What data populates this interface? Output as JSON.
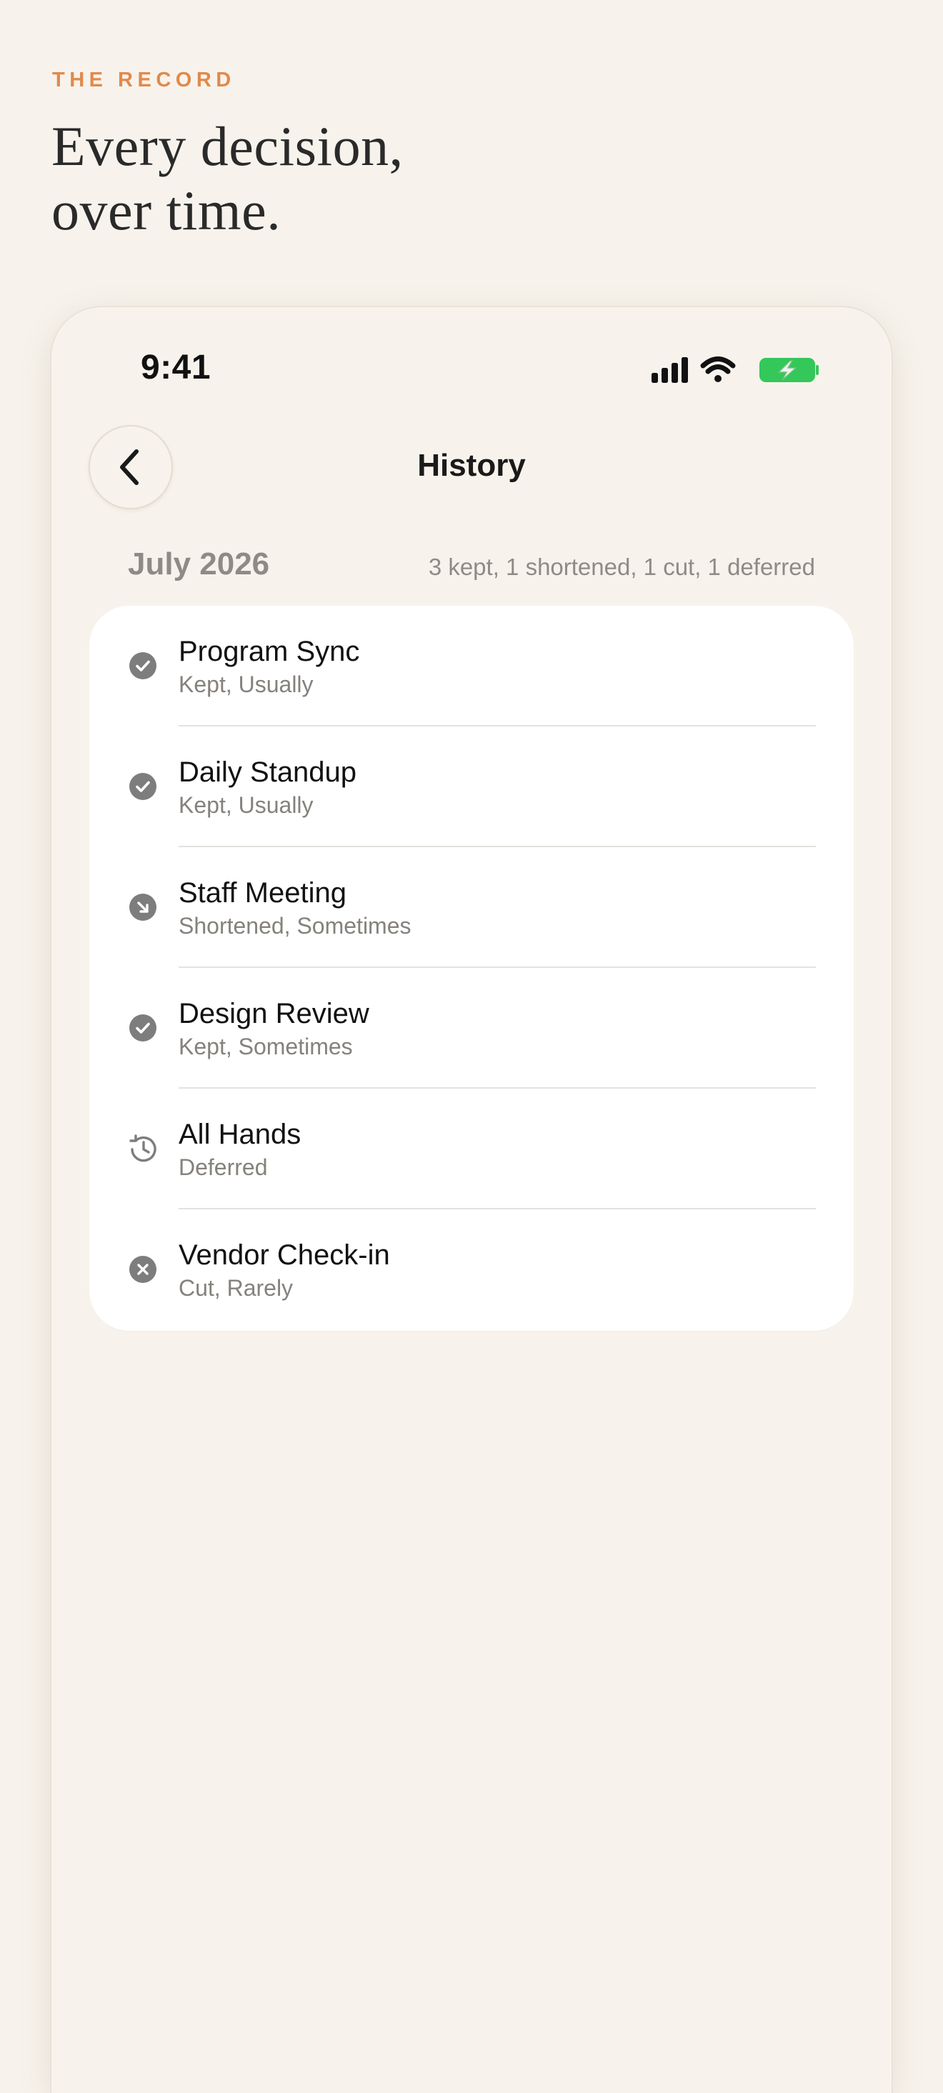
{
  "eyebrow": "THE RECORD",
  "headline": {
    "line1": "Every decision,",
    "line2": "over time."
  },
  "status_bar": {
    "time": "9:41"
  },
  "nav": {
    "title": "History"
  },
  "section": {
    "month": "July 2026",
    "summary": "3 kept, 1 shortened, 1 cut, 1 deferred"
  },
  "items": [
    {
      "title": "Program Sync",
      "subtitle": "Kept, Usually",
      "icon": "check-circle-icon"
    },
    {
      "title": "Daily Standup",
      "subtitle": "Kept, Usually",
      "icon": "check-circle-icon"
    },
    {
      "title": "Staff Meeting",
      "subtitle": "Shortened, Sometimes",
      "icon": "arrow-down-right-circle-icon"
    },
    {
      "title": "Design Review",
      "subtitle": "Kept, Sometimes",
      "icon": "check-circle-icon"
    },
    {
      "title": "All Hands",
      "subtitle": "Deferred",
      "icon": "history-clock-icon"
    },
    {
      "title": "Vendor Check-in",
      "subtitle": "Cut, Rarely",
      "icon": "x-circle-icon"
    }
  ],
  "colors": {
    "accent": "#e08a4b",
    "background": "#f7f3ec",
    "card": "#ffffff",
    "icon": "#7d7d7d",
    "battery": "#34c759"
  }
}
